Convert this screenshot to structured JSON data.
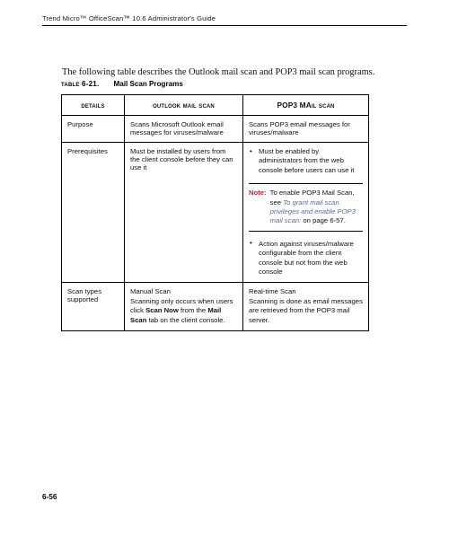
{
  "header": {
    "running_head": "Trend Micro™ OfficeScan™ 10.6 Administrator's Guide"
  },
  "body": {
    "intro_paragraph": "The following table describes the Outlook mail scan and POP3 mail scan programs."
  },
  "table": {
    "caption_label": "Table 6-21.",
    "caption_title": "Mail Scan Programs",
    "columns": [
      {
        "label": "Details"
      },
      {
        "label": "Outlook Mail Scan"
      },
      {
        "label_prefix": "POP3 MA",
        "label_suffix": "il Scan"
      }
    ],
    "rows": [
      {
        "details": "Purpose",
        "outlook": "Scans Microsoft Outlook email messages for viruses/malware",
        "pop3": "Scans POP3 email messages for viruses/malware"
      },
      {
        "details": "Prerequisites",
        "outlook": "Must be installed by users from the client console before they can use it",
        "pop3_bullet_1": "Must be enabled by administrators from the web console before users can use it",
        "pop3_note_label": "Note:",
        "pop3_note_text_before": "To enable POP3 Mail Scan, see ",
        "pop3_note_xref": "To grant mail scan privileges and enable POP3 mail scan:",
        "pop3_note_text_after": " on page 6-57.",
        "pop3_bullet_2": "Action against viruses/malware configurable from the client console but not from the web console"
      },
      {
        "details": "Scan types supported",
        "outlook_line_1": "Manual Scan",
        "outlook_para_before_1": "Scanning only occurs when users click ",
        "outlook_para_bold_1": "Scan Now",
        "outlook_para_mid": " from the ",
        "outlook_para_bold_2": "Mail Scan",
        "outlook_para_after": " tab on the client console.",
        "pop3_line_1": "Real-time Scan",
        "pop3_para": "Scanning is done as email messages are retrieved from the POP3 mail server."
      }
    ]
  },
  "footer": {
    "page_number": "6-56"
  },
  "colors": {
    "note_label": "#cc2229",
    "cross_reference": "#5a6f99",
    "rule": "#000000"
  }
}
